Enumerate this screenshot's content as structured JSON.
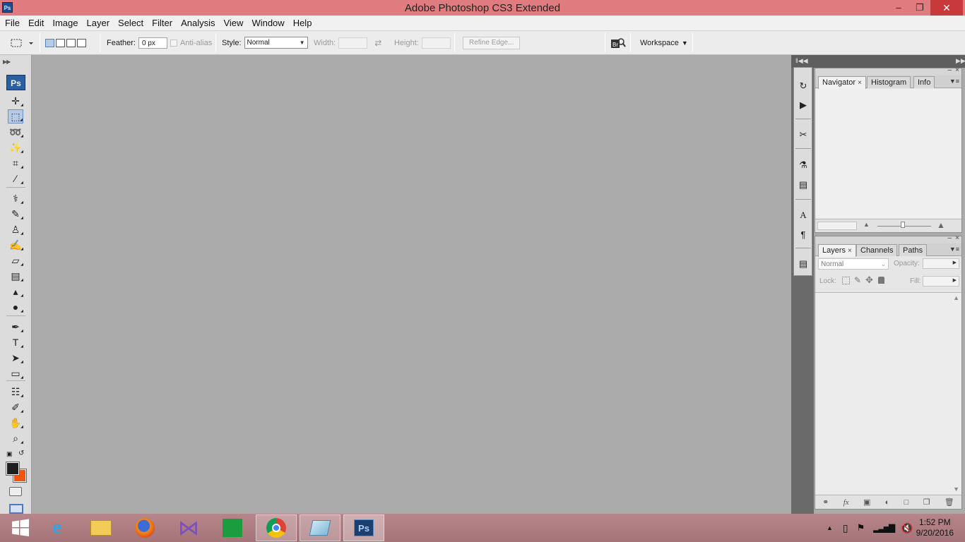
{
  "window": {
    "title": "Adobe Photoshop CS3 Extended",
    "app_icon": "Ps",
    "controls": {
      "minimize": "–",
      "maximize": "❐",
      "close": "✕"
    }
  },
  "menu": [
    "File",
    "Edit",
    "Image",
    "Layer",
    "Select",
    "Filter",
    "Analysis",
    "View",
    "Window",
    "Help"
  ],
  "options": {
    "feather_label": "Feather:",
    "feather_value": "0 px",
    "antialias_label": "Anti-alias",
    "style_label": "Style:",
    "style_value": "Normal",
    "width_label": "Width:",
    "height_label": "Height:",
    "refine_edge": "Refine Edge...",
    "workspace": "Workspace"
  },
  "toolbox": {
    "logo": "Ps",
    "tools": [
      {
        "name": "move-tool",
        "glyph": "✛"
      },
      {
        "name": "marquee-tool",
        "glyph": "⬚"
      },
      {
        "name": "lasso-tool",
        "glyph": "➿"
      },
      {
        "name": "magic-wand-tool",
        "glyph": "✨"
      },
      {
        "name": "crop-tool",
        "glyph": "⌗"
      },
      {
        "name": "slice-tool",
        "glyph": "∕"
      },
      {
        "name": "healing-brush-tool",
        "glyph": "⚕"
      },
      {
        "name": "brush-tool",
        "glyph": "✎"
      },
      {
        "name": "stamp-tool",
        "glyph": "♙"
      },
      {
        "name": "history-brush-tool",
        "glyph": "✍"
      },
      {
        "name": "eraser-tool",
        "glyph": "▱"
      },
      {
        "name": "gradient-tool",
        "glyph": "▤"
      },
      {
        "name": "blur-tool",
        "glyph": "▴"
      },
      {
        "name": "dodge-tool",
        "glyph": "●"
      },
      {
        "name": "pen-tool",
        "glyph": "✒"
      },
      {
        "name": "type-tool",
        "glyph": "T"
      },
      {
        "name": "path-selection-tool",
        "glyph": "➤"
      },
      {
        "name": "shape-tool",
        "glyph": "▭"
      },
      {
        "name": "notes-tool",
        "glyph": "☷"
      },
      {
        "name": "eyedropper-tool",
        "glyph": "✐"
      },
      {
        "name": "hand-tool",
        "glyph": "✋"
      },
      {
        "name": "zoom-tool",
        "glyph": "⌕"
      }
    ],
    "colors": {
      "foreground": "#1f1f1f",
      "background": "#f0560f"
    }
  },
  "panels": {
    "navigator_group": {
      "tabs": [
        "Navigator",
        "Histogram",
        "Info"
      ],
      "active": "Navigator"
    },
    "layers_group": {
      "tabs": [
        "Layers",
        "Channels",
        "Paths"
      ],
      "active": "Layers"
    },
    "layers": {
      "blend_mode": "Normal",
      "opacity_label": "Opacity:",
      "lock_label": "Lock:",
      "fill_label": "Fill:"
    }
  },
  "taskbar": {
    "apps": [
      "start",
      "internet-explorer",
      "file-explorer",
      "firefox",
      "visual-studio",
      "store",
      "chrome",
      "app",
      "photoshop"
    ],
    "photoshop_label": "Ps",
    "time": "1:52 PM",
    "date": "9/20/2016"
  },
  "colors": {
    "titlebar": "#e07c80",
    "canvas": "#ababab",
    "taskbar": "#a97a7f",
    "accent": "#2b5fa3"
  }
}
